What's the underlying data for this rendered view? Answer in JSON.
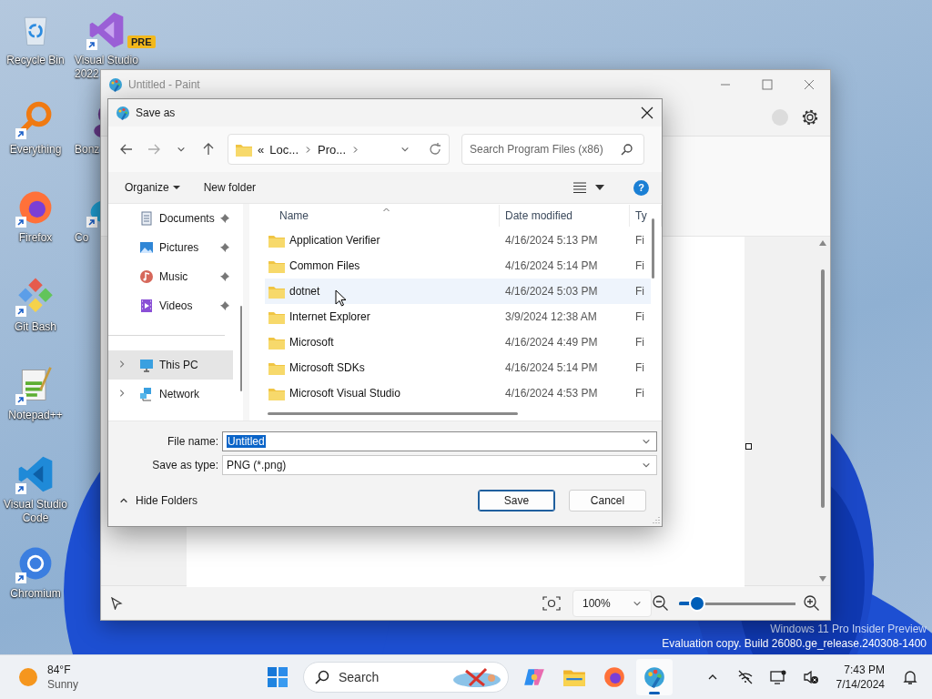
{
  "desktop_icons": {
    "column_1": [
      {
        "label": "Recycle Bin",
        "kind": "recycle-bin",
        "shortcut": false
      },
      {
        "label": "Everything",
        "kind": "everything",
        "shortcut": true
      },
      {
        "label": "Firefox",
        "kind": "firefox",
        "shortcut": true
      },
      {
        "label": "Git Bash",
        "kind": "git",
        "shortcut": true
      },
      {
        "label": "Notepad++",
        "kind": "notepad",
        "shortcut": true
      },
      {
        "label": "Visual Studio Code",
        "kind": "vscode",
        "shortcut": true
      },
      {
        "label": "Chromium",
        "kind": "chromium",
        "shortcut": true
      }
    ],
    "column_2": [
      {
        "label_lines": [
          "Visual Studio",
          "2022"
        ],
        "kind": "visual-studio",
        "shortcut": true,
        "badge": "PRE"
      },
      {
        "label_lines": [
          "Bonz"
        ],
        "kind": "bonzi",
        "shortcut": false
      },
      {
        "label_lines": [
          "Co"
        ],
        "kind": "edge",
        "shortcut": true
      }
    ]
  },
  "paint_window": {
    "title": "Untitled - Paint",
    "zoom": "100%",
    "zoom_slider": {
      "level": 0.16
    }
  },
  "save_dialog": {
    "title": "Save as",
    "address": {
      "overflow": "«",
      "segments": [
        "Loc...",
        "Pro..."
      ]
    },
    "search_placeholder": "Search Program Files (x86)",
    "organize": "Organize",
    "new_folder": "New folder",
    "help": "?",
    "quick_access": [
      {
        "label": "Documents",
        "kind": "documents",
        "pinned": true,
        "selected": false
      },
      {
        "label": "Pictures",
        "kind": "pictures",
        "pinned": true,
        "selected": false
      },
      {
        "label": "Music",
        "kind": "music",
        "pinned": true,
        "selected": false
      },
      {
        "label": "Videos",
        "kind": "videos",
        "pinned": true,
        "selected": false
      }
    ],
    "tree": [
      {
        "label": "This PC",
        "kind": "pc",
        "selected": true,
        "expanded": false
      },
      {
        "label": "Network",
        "kind": "network",
        "selected": false,
        "expanded": false
      }
    ],
    "columns": [
      "Name",
      "Date modified",
      "Ty"
    ],
    "rows": [
      {
        "name": "Application Verifier",
        "date": "4/16/2024 5:13 PM",
        "type": "Fi",
        "hovered": false
      },
      {
        "name": "Common Files",
        "date": "4/16/2024 5:14 PM",
        "type": "Fi",
        "hovered": false
      },
      {
        "name": "dotnet",
        "date": "4/16/2024 5:03 PM",
        "type": "Fi",
        "hovered": true
      },
      {
        "name": "Internet Explorer",
        "date": "3/9/2024 12:38 AM",
        "type": "Fi",
        "hovered": false
      },
      {
        "name": "Microsoft",
        "date": "4/16/2024 4:49 PM",
        "type": "Fi",
        "hovered": false
      },
      {
        "name": "Microsoft SDKs",
        "date": "4/16/2024 5:14 PM",
        "type": "Fi",
        "hovered": false
      },
      {
        "name": "Microsoft Visual Studio",
        "date": "4/16/2024 4:53 PM",
        "type": "Fi",
        "hovered": false
      }
    ],
    "file_name": {
      "label": "File name:",
      "value": "Untitled",
      "selected": true
    },
    "file_type": {
      "label": "Save as type:",
      "value": "PNG (*.png)"
    },
    "hide_folders": "Hide Folders",
    "buttons": [
      {
        "label": "Save",
        "default": true
      },
      {
        "label": "Cancel",
        "default": false
      }
    ]
  },
  "taskbar": {
    "weather": {
      "temperature": "84°F",
      "condition": "Sunny"
    },
    "search": "Search",
    "apps": [
      {
        "kind": "copilot",
        "active": false
      },
      {
        "kind": "file-explorer",
        "active": false
      },
      {
        "kind": "firefox",
        "active": false
      },
      {
        "kind": "paint",
        "active": true
      }
    ],
    "time": "7:43 PM",
    "date": "7/14/2024"
  },
  "watermark": [
    "Windows 11 Pro Insider Preview",
    "Evaluation copy. Build 26080.ge_release.240308-1400"
  ]
}
